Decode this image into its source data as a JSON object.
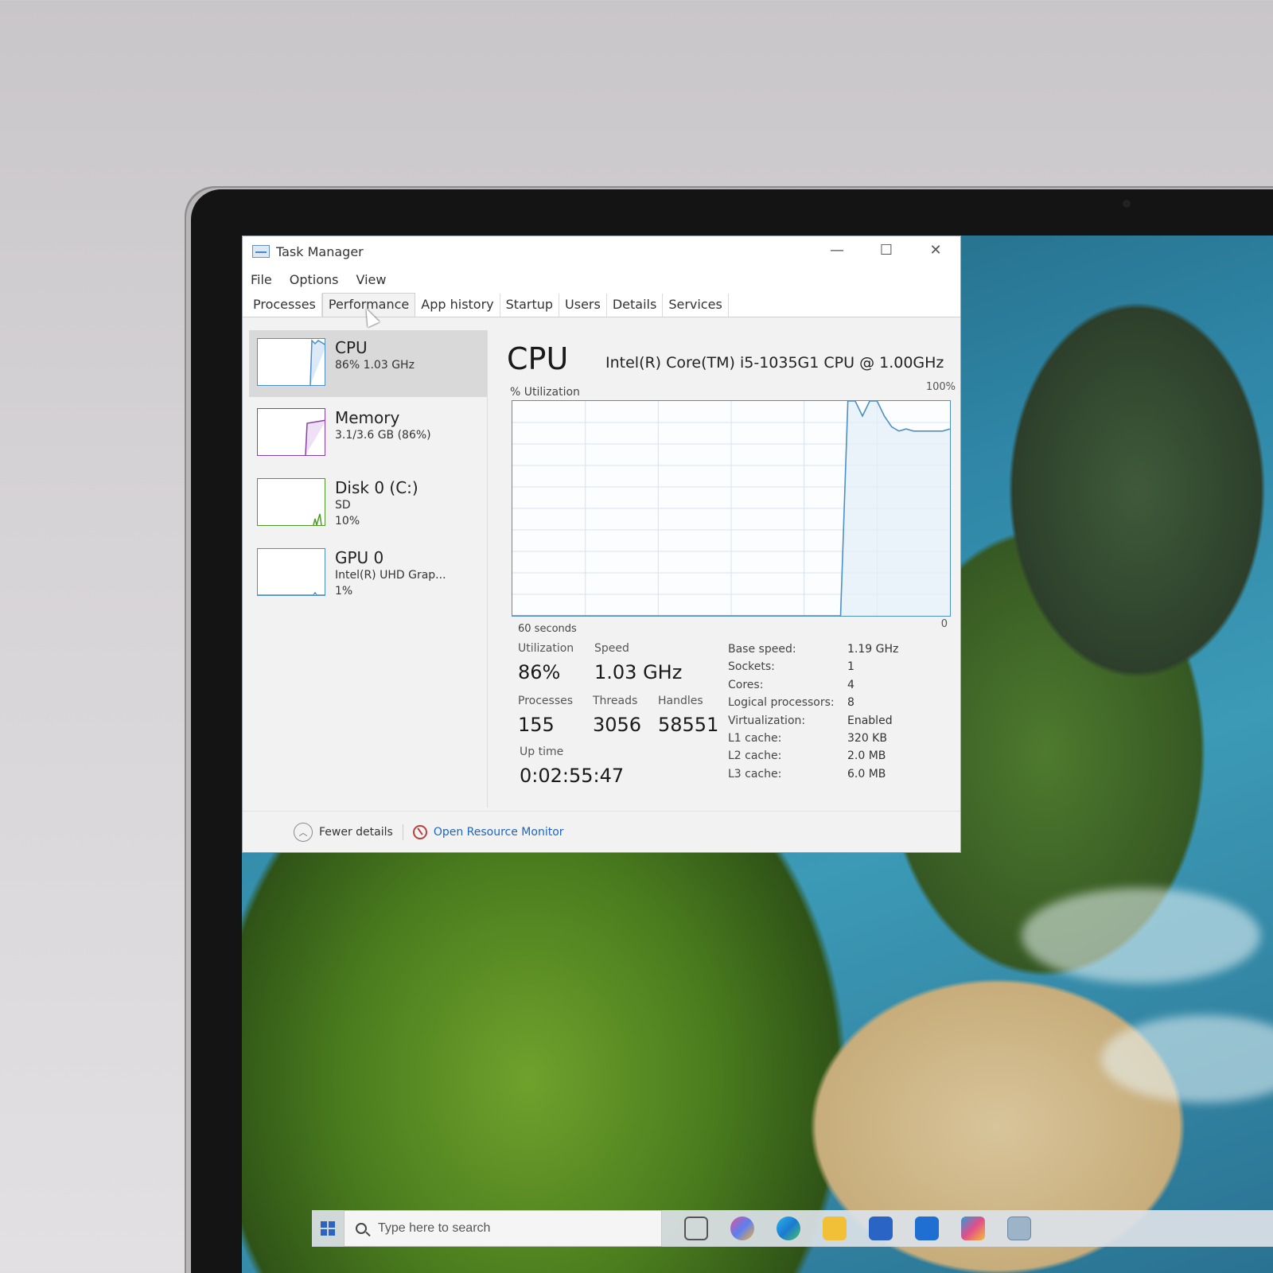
{
  "window": {
    "title": "Task Manager",
    "controls": {
      "minimize": "—",
      "maximize": "☐",
      "close": "✕"
    }
  },
  "menu": [
    "File",
    "Options",
    "View"
  ],
  "tabs": [
    "Processes",
    "Performance",
    "App history",
    "Startup",
    "Users",
    "Details",
    "Services"
  ],
  "active_tab": "Performance",
  "sidebar": [
    {
      "name": "CPU",
      "line1": "86%  1.03 GHz",
      "line2": "",
      "color": "#4b8fc6"
    },
    {
      "name": "Memory",
      "line1": "3.1/3.6 GB (86%)",
      "line2": "",
      "color": "#8b3fa8"
    },
    {
      "name": "Disk 0 (C:)",
      "line1": "SD",
      "line2": "10%",
      "color": "#4e9a2a"
    },
    {
      "name": "GPU 0",
      "line1": "Intel(R) UHD Grap...",
      "line2": "1%",
      "color": "#4b8fc6"
    }
  ],
  "cpu": {
    "title": "CPU",
    "model": "Intel(R) Core(TM) i5-1035G1 CPU @ 1.00GHz",
    "util_label": "% Utilization",
    "max_label": "100%",
    "x_label": "60 seconds",
    "zero_label": "0",
    "stats": {
      "utilization": {
        "label": "Utilization",
        "value": "86%"
      },
      "speed": {
        "label": "Speed",
        "value": "1.03 GHz"
      },
      "processes": {
        "label": "Processes",
        "value": "155"
      },
      "threads": {
        "label": "Threads",
        "value": "3056"
      },
      "handles": {
        "label": "Handles",
        "value": "58551"
      },
      "uptime": {
        "label": "Up time",
        "value": "0:02:55:47"
      }
    },
    "specs": [
      {
        "key": "Base speed:",
        "value": "1.19 GHz"
      },
      {
        "key": "Sockets:",
        "value": "1"
      },
      {
        "key": "Cores:",
        "value": "4"
      },
      {
        "key": "Logical processors:",
        "value": "8"
      },
      {
        "key": "Virtualization:",
        "value": "Enabled"
      },
      {
        "key": "L1 cache:",
        "value": "320 KB"
      },
      {
        "key": "L2 cache:",
        "value": "2.0 MB"
      },
      {
        "key": "L3 cache:",
        "value": "6.0 MB"
      }
    ]
  },
  "footer": {
    "fewer_details": "Fewer details",
    "resource_monitor": "Open Resource Monitor"
  },
  "taskbar": {
    "search_placeholder": "Type here to search",
    "icons": [
      "task-view-icon",
      "copilot-icon",
      "edge-icon",
      "file-explorer-icon",
      "store-icon",
      "mail-icon",
      "photos-icon",
      "task-manager-icon"
    ]
  },
  "chart_data": {
    "type": "line",
    "title": "",
    "xlabel": "60 seconds",
    "ylabel": "% Utilization",
    "ylim": [
      0,
      100
    ],
    "x": [
      60,
      15,
      14,
      13,
      12,
      11,
      10,
      9,
      8,
      7,
      6,
      5,
      4,
      3,
      2,
      1,
      0
    ],
    "series": [
      {
        "values": [
          0,
          0,
          100,
          100,
          93,
          100,
          100,
          93,
          88,
          86,
          87,
          86,
          86,
          86,
          86,
          86,
          87
        ]
      }
    ],
    "grid": true,
    "colors": {
      "line": "#4b8fc6",
      "grid": "#d4e4f2"
    }
  }
}
